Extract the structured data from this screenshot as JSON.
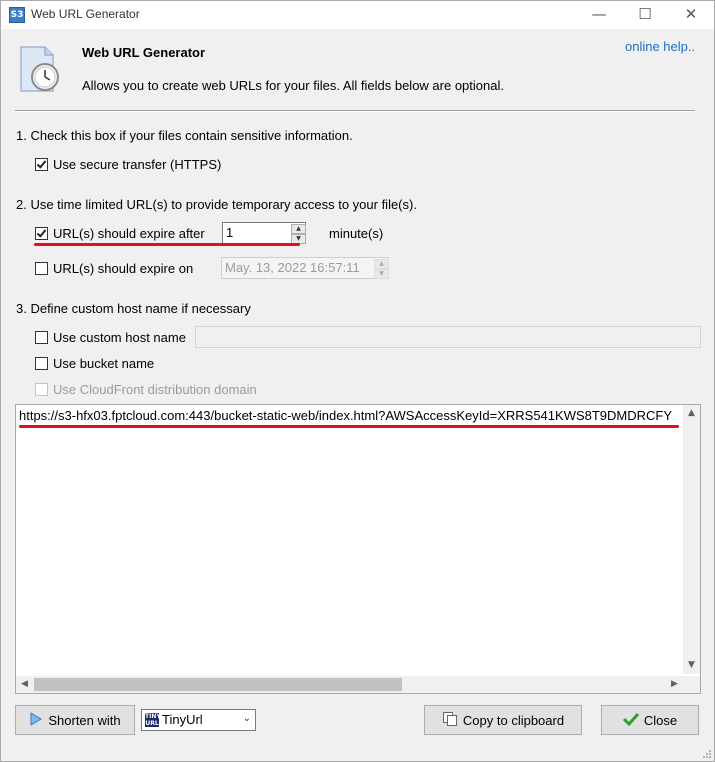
{
  "window": {
    "title": "Web URL Generator",
    "app_icon_text": "S3",
    "controls": {
      "minimize": "—",
      "maximize": "☐",
      "close": "✕"
    }
  },
  "header": {
    "title": "Web URL Generator",
    "description": "Allows you to create web URLs for your files.  All fields below are optional.",
    "help_link": "online help.."
  },
  "section1": {
    "heading": "1. Check this box if your files contain sensitive information.",
    "https_checkbox": {
      "label": "Use secure transfer (HTTPS)",
      "checked": true
    }
  },
  "section2": {
    "heading": "2. Use time limited URL(s) to provide temporary access to your file(s).",
    "expire_after": {
      "label": "URL(s) should expire after",
      "checked": true,
      "value": "1",
      "unit": "minute(s)"
    },
    "expire_on": {
      "label": "URL(s) should expire on",
      "checked": false,
      "value": "May. 13, 2022 16:57:11"
    }
  },
  "section3": {
    "heading": "3. Define custom host name if necessary",
    "custom_host": {
      "label": "Use custom host name",
      "checked": false,
      "value": ""
    },
    "bucket_name": {
      "label": "Use bucket name",
      "checked": false
    },
    "cloudfront": {
      "label": "Use CloudFront distribution domain",
      "checked": false,
      "enabled": false
    }
  },
  "result": {
    "url": "https://s3-hfx03.fptcloud.com:443/bucket-static-web/index.html?AWSAccessKeyId=XRRS541KWS8T9DMDRCFY"
  },
  "footer": {
    "shorten_button": "Shorten with",
    "shortener_selected": "TinyUrl",
    "shortener_icon_text": "TINY URL",
    "copy_button": "Copy to clipboard",
    "close_button": "Close"
  },
  "colors": {
    "annotation_red": "#e0101e",
    "link_blue": "#1a6fc9",
    "dialog_bg": "#f0f0f0"
  }
}
